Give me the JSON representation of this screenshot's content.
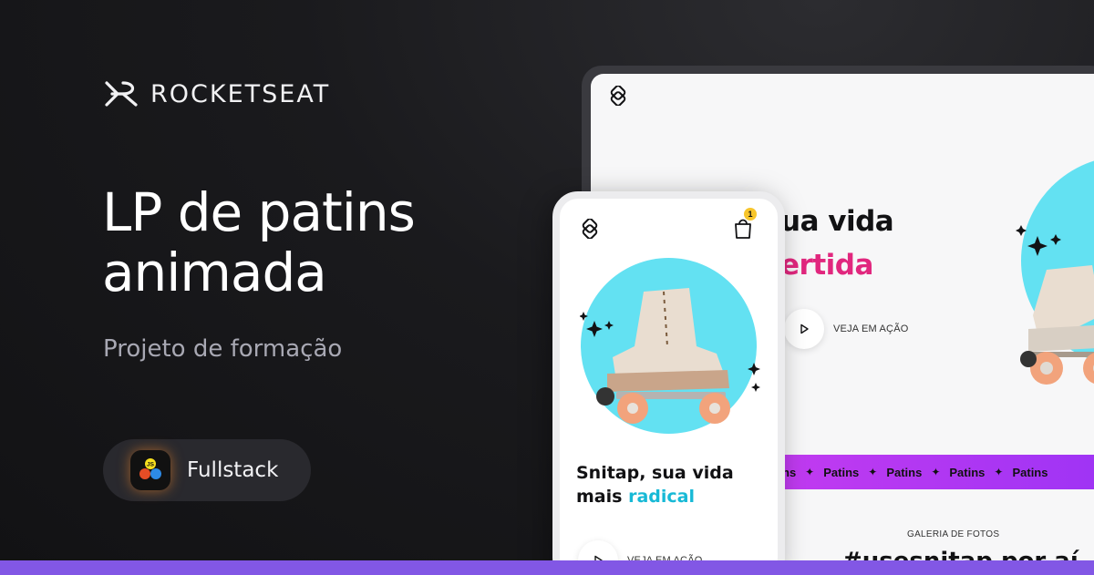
{
  "brand": {
    "name": "ROCKETSEAT",
    "logo_icon": "rocketseat-logo-icon"
  },
  "hero": {
    "title_line1": "LP de patins",
    "title_line2": "animada",
    "subtitle": "Projeto de formação"
  },
  "chip": {
    "label": "Fullstack",
    "icon": "js-stack-icon"
  },
  "desktop_mockup": {
    "headline_line1": "ua vida",
    "headline_line2": "ertida",
    "cta_label": "VEJA EM AÇÃO",
    "marquee_items": [
      "ns",
      "Patins",
      "Patins",
      "Patins",
      "Patins"
    ],
    "gallery_label": "GALERIA DE FOTOS",
    "gallery_title": "#usesnitap por aí"
  },
  "phone_mockup": {
    "headline_line1": "Snitap, sua vida",
    "headline_line2_prefix": "mais",
    "headline_line2_accent": "radical",
    "cta_label": "VEJA EM AÇÃO",
    "cart_count": "1"
  },
  "colors": {
    "background": "#121214",
    "accent_purple": "#8257e5",
    "cyan": "#63e1f2",
    "pink": "#e1277e",
    "radical_cyan": "#17b9d6"
  }
}
